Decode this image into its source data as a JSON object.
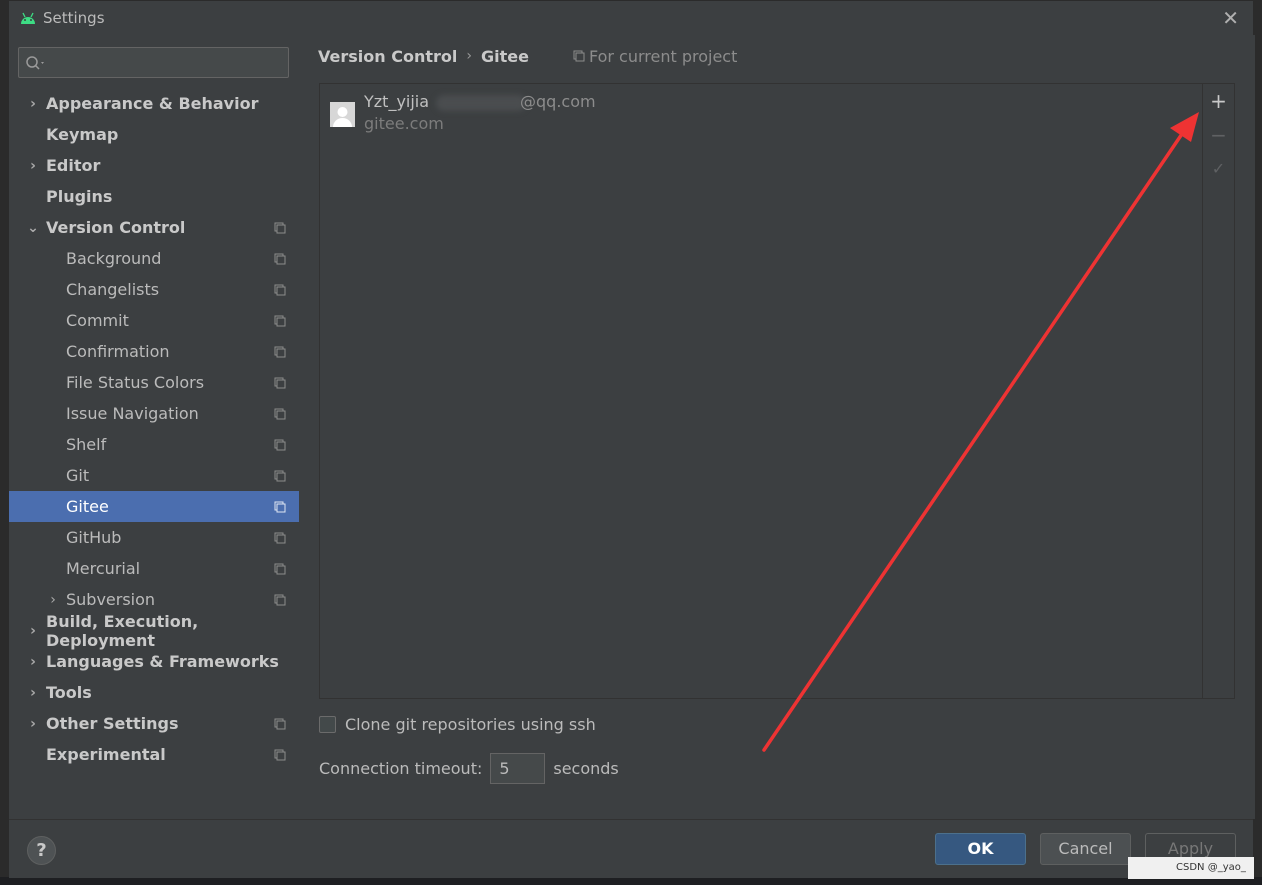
{
  "window": {
    "title": "Settings",
    "close_glyph": "✕"
  },
  "search": {
    "placeholder": ""
  },
  "sidebar": {
    "items": [
      {
        "label": "Appearance & Behavior",
        "level": 0,
        "bold": true,
        "expander": "›",
        "project": false
      },
      {
        "label": "Keymap",
        "level": 0,
        "bold": true,
        "expander": "",
        "project": false
      },
      {
        "label": "Editor",
        "level": 0,
        "bold": true,
        "expander": "›",
        "project": false
      },
      {
        "label": "Plugins",
        "level": 0,
        "bold": true,
        "expander": "",
        "project": false
      },
      {
        "label": "Version Control",
        "level": 0,
        "bold": true,
        "expander": "⌄",
        "project": true
      },
      {
        "label": "Background",
        "level": 1,
        "bold": false,
        "expander": "",
        "project": true
      },
      {
        "label": "Changelists",
        "level": 1,
        "bold": false,
        "expander": "",
        "project": true
      },
      {
        "label": "Commit",
        "level": 1,
        "bold": false,
        "expander": "",
        "project": true
      },
      {
        "label": "Confirmation",
        "level": 1,
        "bold": false,
        "expander": "",
        "project": true
      },
      {
        "label": "File Status Colors",
        "level": 1,
        "bold": false,
        "expander": "",
        "project": true
      },
      {
        "label": "Issue Navigation",
        "level": 1,
        "bold": false,
        "expander": "",
        "project": true
      },
      {
        "label": "Shelf",
        "level": 1,
        "bold": false,
        "expander": "",
        "project": true
      },
      {
        "label": "Git",
        "level": 1,
        "bold": false,
        "expander": "",
        "project": true
      },
      {
        "label": "Gitee",
        "level": 1,
        "bold": false,
        "expander": "",
        "project": true,
        "selected": true
      },
      {
        "label": "GitHub",
        "level": 1,
        "bold": false,
        "expander": "",
        "project": true
      },
      {
        "label": "Mercurial",
        "level": 1,
        "bold": false,
        "expander": "",
        "project": true
      },
      {
        "label": "Subversion",
        "level": 1,
        "bold": false,
        "expander": "›",
        "project": true
      },
      {
        "label": "Build, Execution, Deployment",
        "level": 0,
        "bold": true,
        "expander": "›",
        "project": false
      },
      {
        "label": "Languages & Frameworks",
        "level": 0,
        "bold": true,
        "expander": "›",
        "project": false
      },
      {
        "label": "Tools",
        "level": 0,
        "bold": true,
        "expander": "›",
        "project": false
      },
      {
        "label": "Other Settings",
        "level": 0,
        "bold": true,
        "expander": "›",
        "project": true
      },
      {
        "label": "Experimental",
        "level": 0,
        "bold": true,
        "expander": "",
        "project": true
      }
    ]
  },
  "breadcrumb": {
    "parent": "Version Control",
    "separator": "›",
    "current": "Gitee",
    "scope": "For current project"
  },
  "accounts": {
    "toolbar": {
      "add": "+",
      "remove": "−",
      "check": "✓"
    },
    "rows": [
      {
        "name": "Yzt_yijia",
        "email": "@qq.com",
        "server": "gitee.com"
      }
    ]
  },
  "options": {
    "clone_ssh_label": "Clone git repositories using ssh",
    "clone_ssh_checked": false,
    "timeout_label": "Connection timeout:",
    "timeout_value": "5",
    "timeout_unit": "seconds"
  },
  "footer": {
    "help": "?",
    "ok": "OK",
    "cancel": "Cancel",
    "apply": "Apply"
  },
  "watermark": "CSDN @_yao_",
  "colors": {
    "selection": "#4b6eaf",
    "ok_button": "#365880",
    "annotation_arrow": "#ee3333",
    "android_logo": "#3ddc84"
  }
}
